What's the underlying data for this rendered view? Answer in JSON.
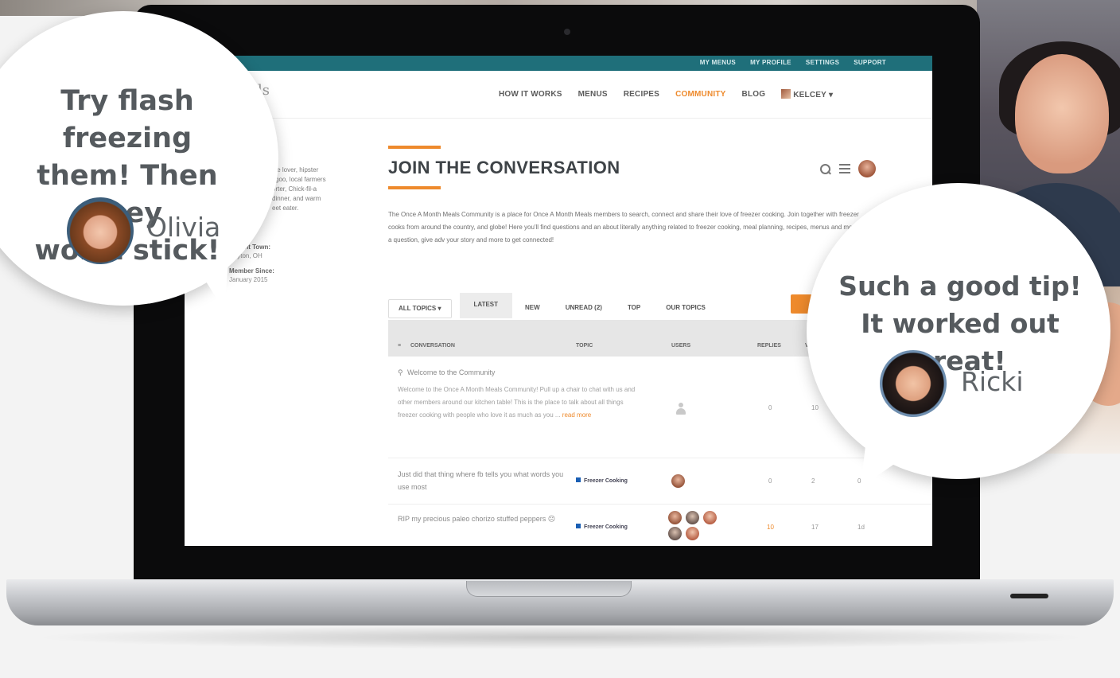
{
  "topbar": {
    "links": [
      "MY MENUS",
      "MY PROFILE",
      "SETTINGS",
      "SUPPORT"
    ]
  },
  "nav": {
    "logo_fragment": "ls",
    "items": [
      "HOW IT WORKS",
      "MENUS",
      "RECIPES",
      "COMMUNITY",
      "BLOG"
    ],
    "active": "COMMUNITY",
    "user": "KELCEY"
  },
  "sidebar": {
    "bio_lines": [
      "pie lover, hipster",
      "l goo, local farmers",
      "orter, Chick-fil-a",
      "dinner, and warm",
      "eet eater."
    ],
    "current_town_label": "Current Town:",
    "current_town_value": "Dayton, OH",
    "member_since_label": "Member Since:",
    "member_since_value": "January 2015"
  },
  "main": {
    "title": "JOIN THE CONVERSATION",
    "intro": "The Once A Month Meals Community is a place for Once A Month Meals members to search, connect and share their love of freezer cooking. Join together with freezer cooks from around the country, and globe! Here you'll find questions and an about literally anything related to freezer cooking, meal planning, recipes, menus and more. Ask a question, give adv your story and more to get connected!",
    "tabs": [
      "ALL TOPICS",
      "LATEST",
      "NEW",
      "UNREAD (2)",
      "TOP",
      "OUR TOPICS"
    ],
    "active_tab": "LATEST",
    "columns": [
      "CONVERSATION",
      "TOPIC",
      "USERS",
      "REPLIES",
      "V"
    ]
  },
  "rows": [
    {
      "title": "Welcome to the Community",
      "excerpt": "Welcome to the Once A Month Meals Community! Pull up a chair to chat with us and other members around our kitchen table! This is the place to talk about all things freezer cooking with people who love it as much as you ...",
      "read_more": "read more",
      "topic": "",
      "replies": "0",
      "views": "10",
      "activity": ""
    },
    {
      "title": "Just did that thing where fb tells you what words you use most",
      "topic": "Freezer Cooking",
      "replies": "0",
      "views": "2",
      "activity": "0"
    },
    {
      "title": "RIP my precious paleo chorizo stuffed peppers ☹",
      "topic": "Freezer Cooking",
      "replies": "10",
      "views": "17",
      "activity": "1d"
    }
  ],
  "bubbles": {
    "left": {
      "lines": [
        "Try flash freezing",
        "them! Then they",
        "won’t stick!"
      ],
      "name": "Olivia"
    },
    "right": {
      "lines": [
        "Such a good tip!",
        "It worked out great!"
      ],
      "name": "Ricki"
    }
  },
  "colors": {
    "accent": "#ee8a2c",
    "topbar": "#1f6f7a",
    "title": "#3e4347"
  }
}
